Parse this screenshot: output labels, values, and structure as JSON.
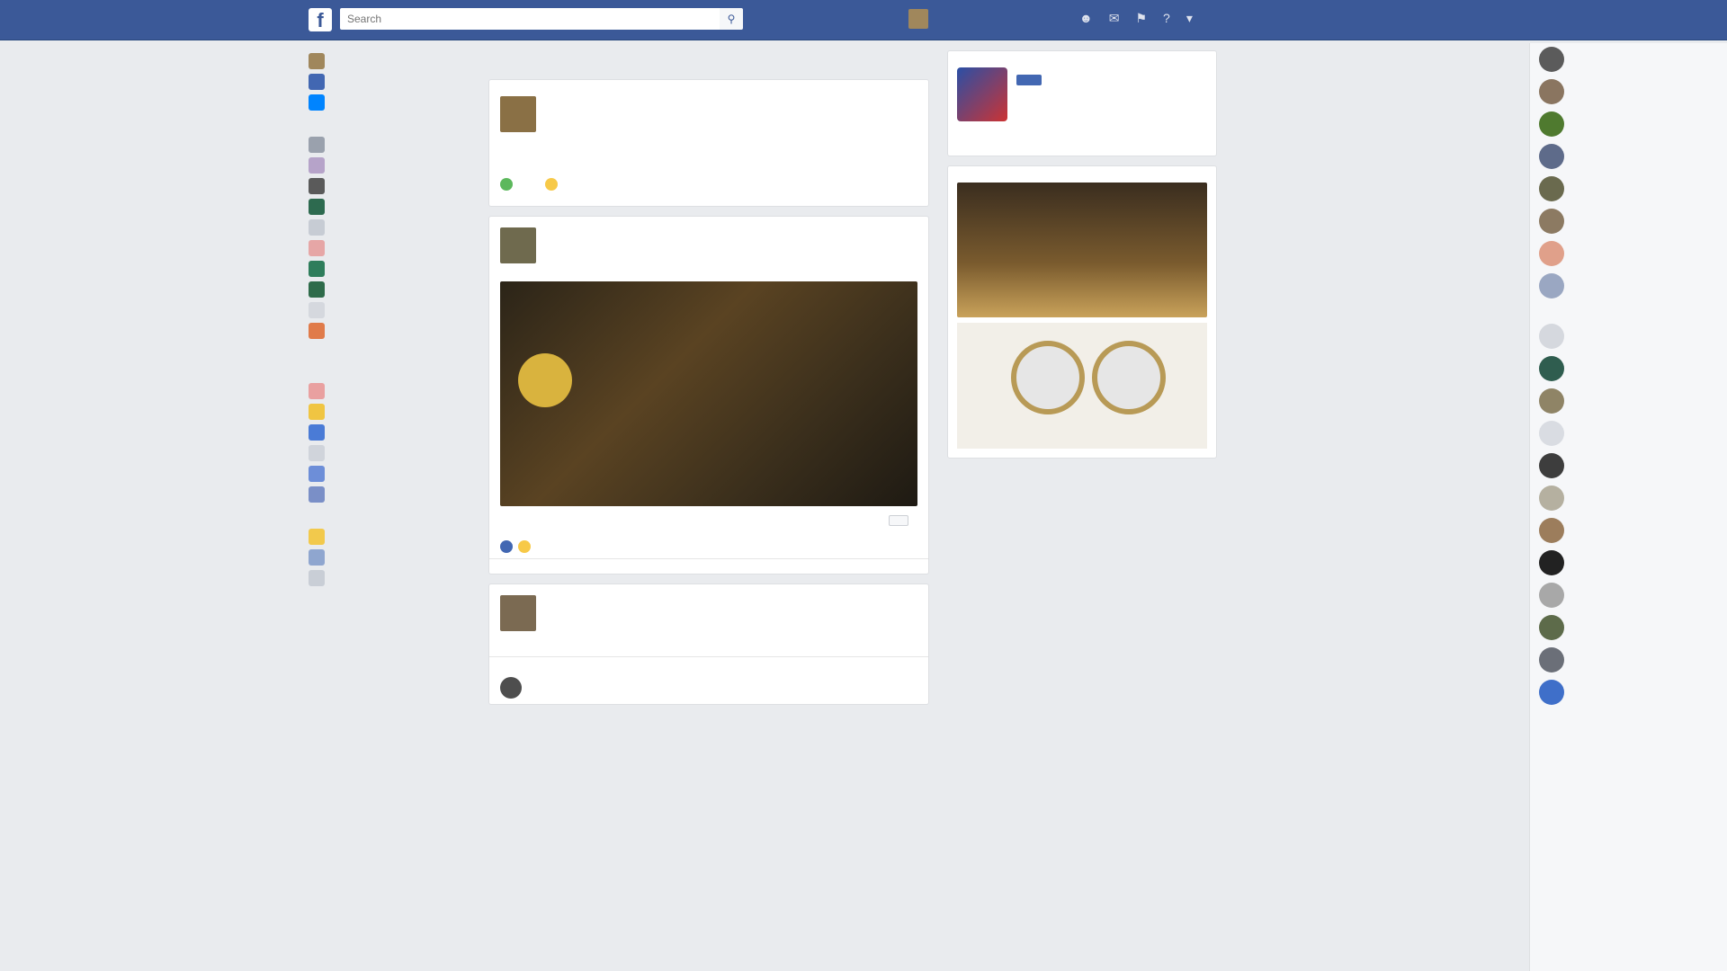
{
  "topbar": {
    "logo": "f",
    "search_placeholder": "Search",
    "user_name": "",
    "home_label": "",
    "find_friends_label": ""
  },
  "left": {
    "profile_name": "",
    "items": [
      {
        "label": "",
        "icon": "news-feed-icon"
      },
      {
        "label": "",
        "icon": "messenger-icon"
      }
    ],
    "shortcuts_head": "",
    "shortcuts": [
      "",
      "",
      "",
      "",
      "",
      "",
      "",
      "",
      "",
      ""
    ],
    "more": "",
    "explore_head": "",
    "explore": [
      "",
      "",
      "",
      "",
      "",
      ""
    ],
    "create_head": "",
    "create": [
      "",
      "",
      ""
    ]
  },
  "feed": {
    "tabs": [
      "",
      ""
    ],
    "composer_placeholder": "",
    "composer_actions": [
      "",
      "",
      ""
    ],
    "post1": {
      "author": "",
      "meta": "",
      "text": "",
      "see_more": "",
      "banner_title": "",
      "banner_sub": "",
      "link_title": "",
      "link_sub": "",
      "link_button": "",
      "reactions": "",
      "actions": [
        "",
        "",
        ""
      ]
    },
    "post2": {
      "author": "",
      "meta": "",
      "text": "",
      "actions": [
        "",
        ""
      ],
      "comment": ""
    }
  },
  "right": {
    "your_pages": "",
    "page_name": "",
    "page_button": "",
    "this_week": "",
    "stats": [
      {
        "n": "",
        "l": ""
      },
      {
        "n": "",
        "l": ""
      }
    ],
    "recent_posts_head": "",
    "recent_links": [
      "",
      ""
    ],
    "see_all": "",
    "sponsored_head": "",
    "ad_caption": ""
  },
  "chat": {
    "contacts": [
      "",
      "",
      "",
      "",
      "",
      "",
      "",
      "",
      "",
      "",
      "",
      "",
      "",
      "",
      "",
      "",
      "",
      "",
      "",
      ""
    ],
    "group_head": ""
  }
}
